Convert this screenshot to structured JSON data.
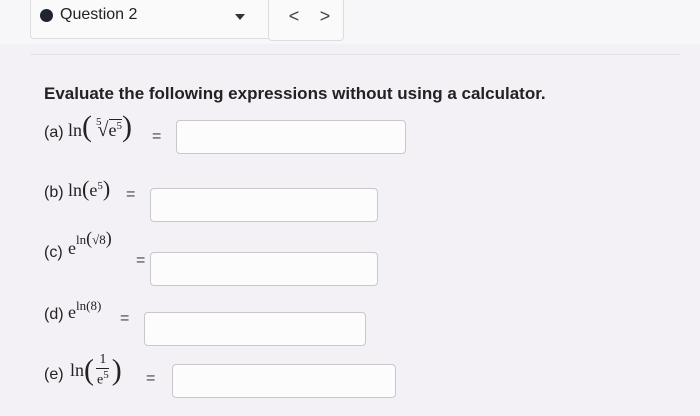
{
  "header": {
    "question_label": "Question 2",
    "prev_symbol": "<",
    "next_symbol": ">"
  },
  "instructions": "Evaluate the following expressions without using a calculator.",
  "parts": [
    {
      "label": "(a)",
      "fn": "ln",
      "root_index": "5",
      "base": "e",
      "exponent": "5",
      "equals": "="
    },
    {
      "label": "(b)",
      "fn": "ln",
      "base": "e",
      "exponent": "5",
      "equals": "="
    },
    {
      "label": "(c)",
      "base": "e",
      "exponent_fn": "ln",
      "exponent_arg": "√8",
      "equals": "="
    },
    {
      "label": "(d)",
      "base": "e",
      "exponent_fn": "ln",
      "exponent_arg": "8",
      "equals": "="
    },
    {
      "label": "(e)",
      "fn": "ln",
      "numerator": "1",
      "denominator_base": "e",
      "denominator_exponent": "5",
      "equals": "="
    }
  ],
  "icons": {
    "question_dot": "filled-circle-icon",
    "dropdown": "caret-down-icon"
  },
  "colors": {
    "background": "#f3f1f5",
    "dot": "#1f2430",
    "field_border": "#c9c7cc"
  }
}
